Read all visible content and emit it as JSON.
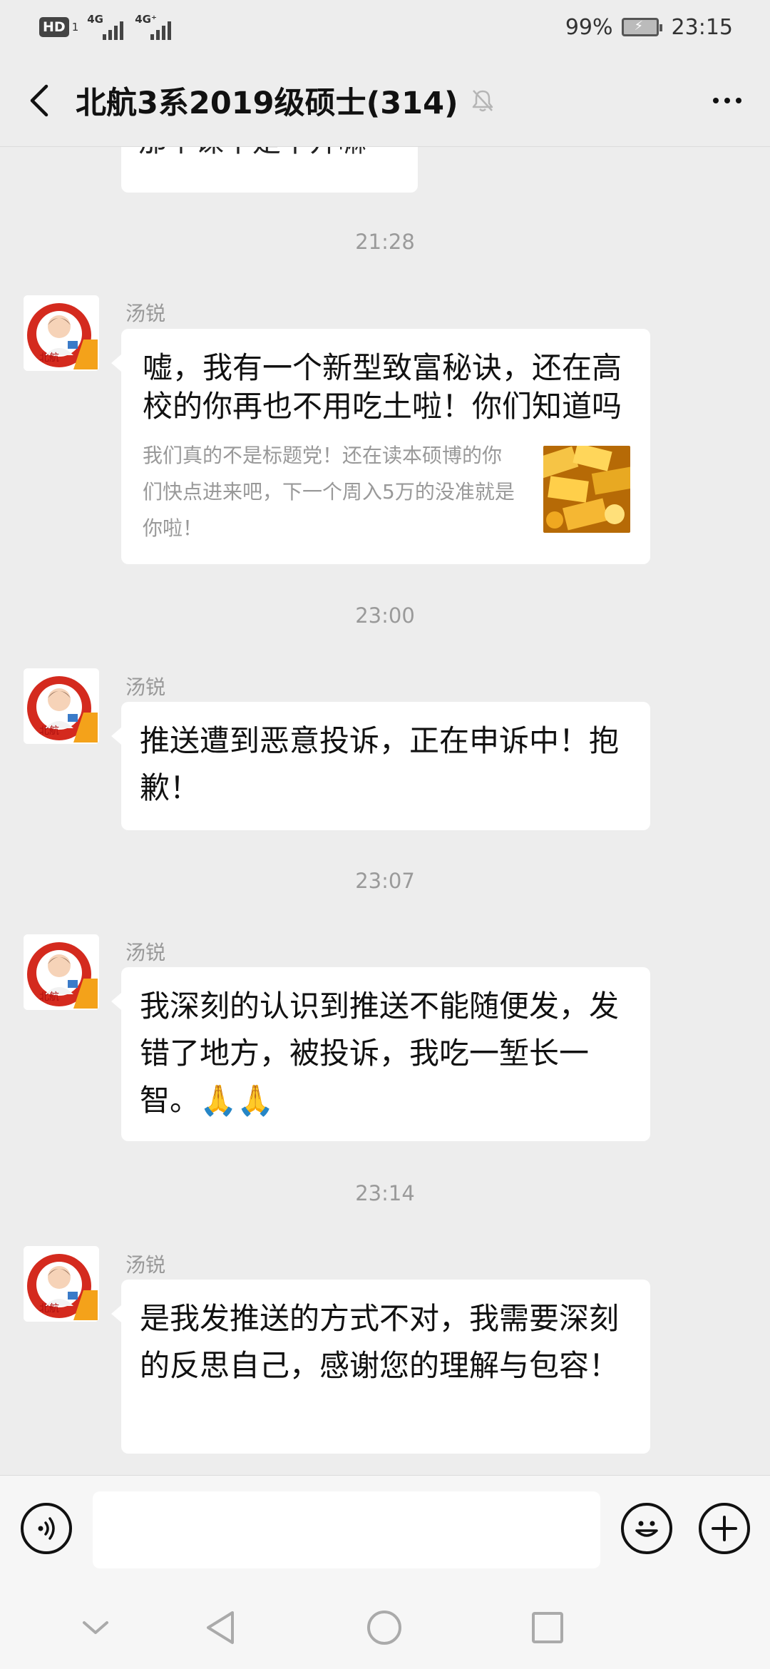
{
  "status_bar": {
    "hd_label": "HD",
    "hd_sub": "1",
    "signal1_label": "4G",
    "signal2_label": "4G⁺",
    "battery_pct": "99%",
    "time": "23:15"
  },
  "header": {
    "title": "北航3系2019级硕士(314)",
    "muted": true
  },
  "messages": {
    "partial_text": "那个课不是不开嘛",
    "items": [
      {
        "timestamp": "21:28",
        "sender": "汤锐",
        "type": "link",
        "title": "嘘，我有一个新型致富秘诀，还在高校的你再也不用吃土啦！你们知道吗",
        "desc": "我们真的不是标题党！还在读本硕博的你们快点进来吧，下一个周入5万的没准就是你啦！"
      },
      {
        "timestamp": "23:00",
        "sender": "汤锐",
        "type": "text",
        "text": "推送遭到恶意投诉，正在申诉中！抱歉！"
      },
      {
        "timestamp": "23:07",
        "sender": "汤锐",
        "type": "text",
        "text": "我深刻的认识到推送不能随便发，发错了地方，被投诉，我吃一堑长一智。🙏🙏"
      },
      {
        "timestamp": "23:14",
        "sender": "汤锐",
        "type": "text",
        "text": "是我发推送的方式不对，我需要深刻的反思自己，感谢您的理解与包容！"
      }
    ]
  },
  "input": {
    "value": "",
    "placeholder": ""
  },
  "icons": {
    "back": "chevron-left-icon",
    "mute": "bell-off-icon",
    "more": "more-dots-icon",
    "voice": "voice-icon",
    "emoji": "emoji-icon",
    "plus": "plus-icon"
  },
  "colors": {
    "background": "#ededed",
    "bubble": "#ffffff",
    "timestamp": "#9a9a9a",
    "avatar_accent": "#d42a1e"
  }
}
